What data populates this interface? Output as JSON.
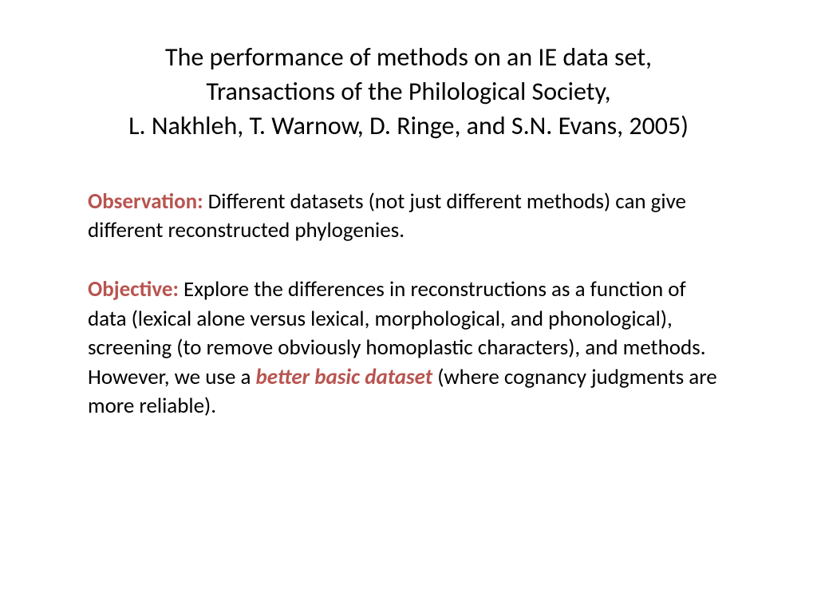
{
  "title": {
    "line1": "The performance of methods on an IE data set,",
    "line2": "Transactions of the Philological Society,",
    "line3": "L. Nakhleh, T. Warnow, D. Ringe, and S.N. Evans, 2005)"
  },
  "observation": {
    "label": "Observation:",
    "text": " Different datasets (not just different methods) can give different reconstructed phylogenies."
  },
  "objective": {
    "label": "Objective:",
    "text_before": " Explore the differences in reconstructions as a function of data (lexical alone versus lexical, morphological, and phonological), screening (to remove obviously homoplastic characters), and methods. However, we use a ",
    "emph": "better basic dataset",
    "text_after": " (where cognancy judgments are more reliable)."
  }
}
